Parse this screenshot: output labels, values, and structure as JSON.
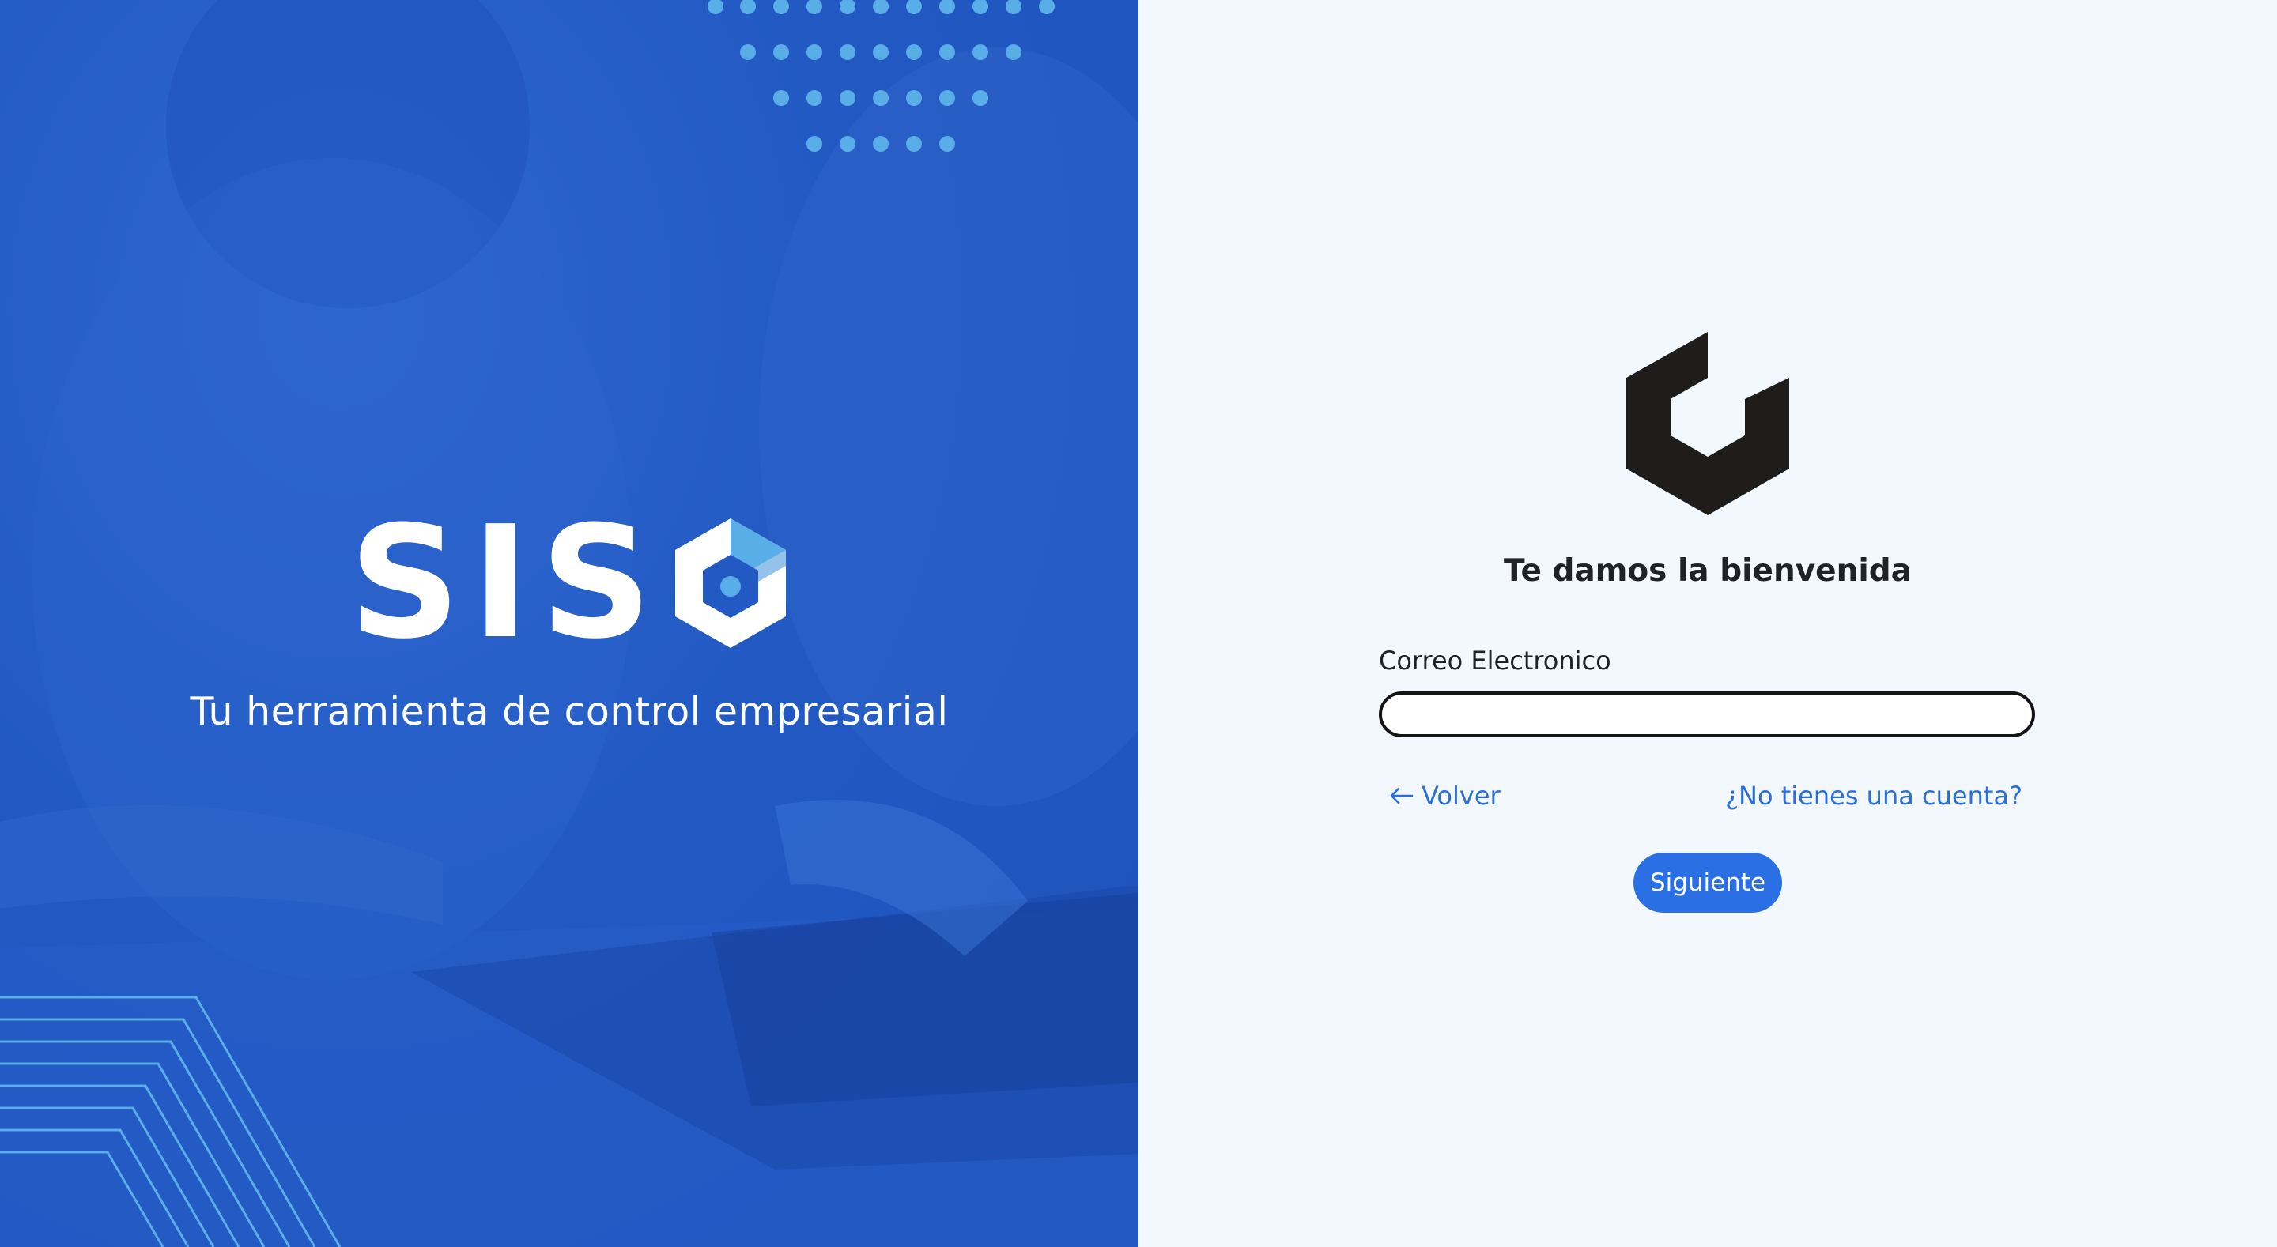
{
  "hero": {
    "brand_name": "SISO",
    "brand_letters": "SIS",
    "tagline": "Tu herramienta de control empresarial",
    "background_color": "#2259c3",
    "accent_color": "#5aaee8",
    "decor_dots_icon": "dot-grid-icon",
    "decor_lines_icon": "chevron-lines-icon"
  },
  "login": {
    "logo_icon": "hexagon-logo-icon",
    "welcome_title": "Te damos la bienvenida",
    "email_label": "Correo Electronico",
    "email_value": "",
    "email_placeholder": "",
    "back_arrow_icon": "arrow-left-icon",
    "back_label": "Volver",
    "signup_label": "¿No tienes una cuenta?",
    "next_label": "Siguiente",
    "link_color": "#2a6fd8",
    "button_color": "#2a6fe4"
  }
}
